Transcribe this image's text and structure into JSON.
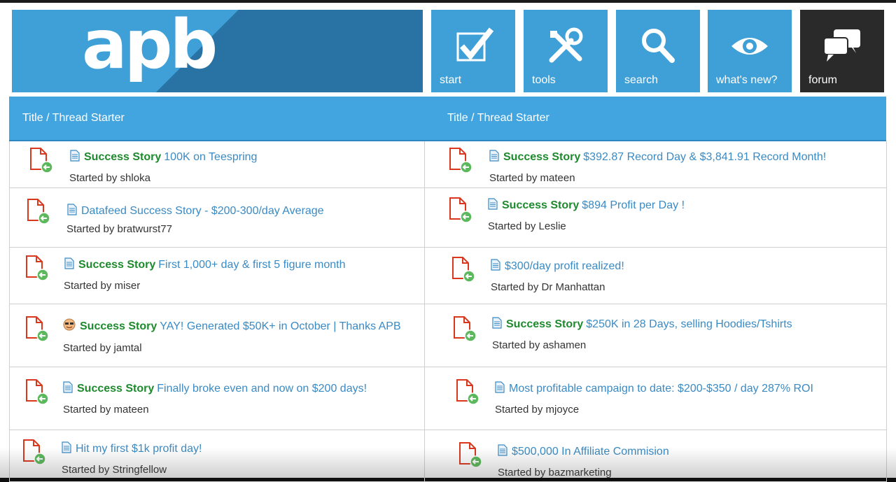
{
  "header": {
    "logo_text": "apb",
    "nav": [
      {
        "label": "start",
        "icon": "checkbox-icon"
      },
      {
        "label": "tools",
        "icon": "tools-icon"
      },
      {
        "label": "search",
        "icon": "search-icon"
      },
      {
        "label": "what's new?",
        "icon": "eye-icon"
      },
      {
        "label": "forum",
        "icon": "chat-bubbles-icon",
        "active": true
      }
    ]
  },
  "table": {
    "left_header": "Title / Thread Starter",
    "right_header": "Title / Thread Starter",
    "started_by_label": "Started by",
    "left": [
      {
        "prefix": "Success Story",
        "title": "100K on Teespring",
        "starter": "shloka",
        "icon": "doc"
      },
      {
        "prefix": "",
        "title": "Datafeed Success Story - $200-300/day Average",
        "starter": "bratwurst77",
        "icon": "doc"
      },
      {
        "prefix": "Success Story",
        "title": "First 1,000+ day & first 5 figure month",
        "starter": "miser",
        "icon": "doc"
      },
      {
        "prefix": "Success Story",
        "title": "YAY! Generated $50K+ in October | Thanks APB",
        "starter": "jamtal",
        "icon": "cool-face"
      },
      {
        "prefix": "Success Story",
        "title": "Finally broke even and now on $200 days!",
        "starter": "mateen",
        "icon": "doc"
      },
      {
        "prefix": "",
        "title": "Hit my first $1k profit day!",
        "starter": "Stringfellow",
        "icon": "doc"
      }
    ],
    "right": [
      {
        "prefix": "Success Story",
        "title": "$392.87 Record Day & $3,841.91 Record Month!",
        "starter": "mateen",
        "icon": "doc"
      },
      {
        "prefix": "Success Story",
        "title": "$894 Profit per Day !",
        "starter": "Leslie",
        "icon": "doc"
      },
      {
        "prefix": "",
        "title": "$300/day profit realized!",
        "starter": "Dr Manhattan",
        "icon": "doc"
      },
      {
        "prefix": "Success Story",
        "title": "$250K in 28 Days, selling Hoodies/Tshirts",
        "starter": "ashamen",
        "icon": "doc"
      },
      {
        "prefix": "",
        "title": "Most profitable campaign to date: $200-$350 / day 287% ROI",
        "starter": "mjoyce",
        "icon": "doc"
      },
      {
        "prefix": "",
        "title": "$500,000 In Affiliate Commision",
        "starter": "bazmarketing",
        "icon": "doc"
      }
    ]
  },
  "colors": {
    "brand_blue": "#3fa0d8",
    "header_blue": "#42a5e0",
    "prefix_green": "#1e8a2e",
    "link_blue": "#3a8ac4",
    "thread_icon_red": "#d9381e",
    "thread_icon_green": "#5cb85c"
  }
}
